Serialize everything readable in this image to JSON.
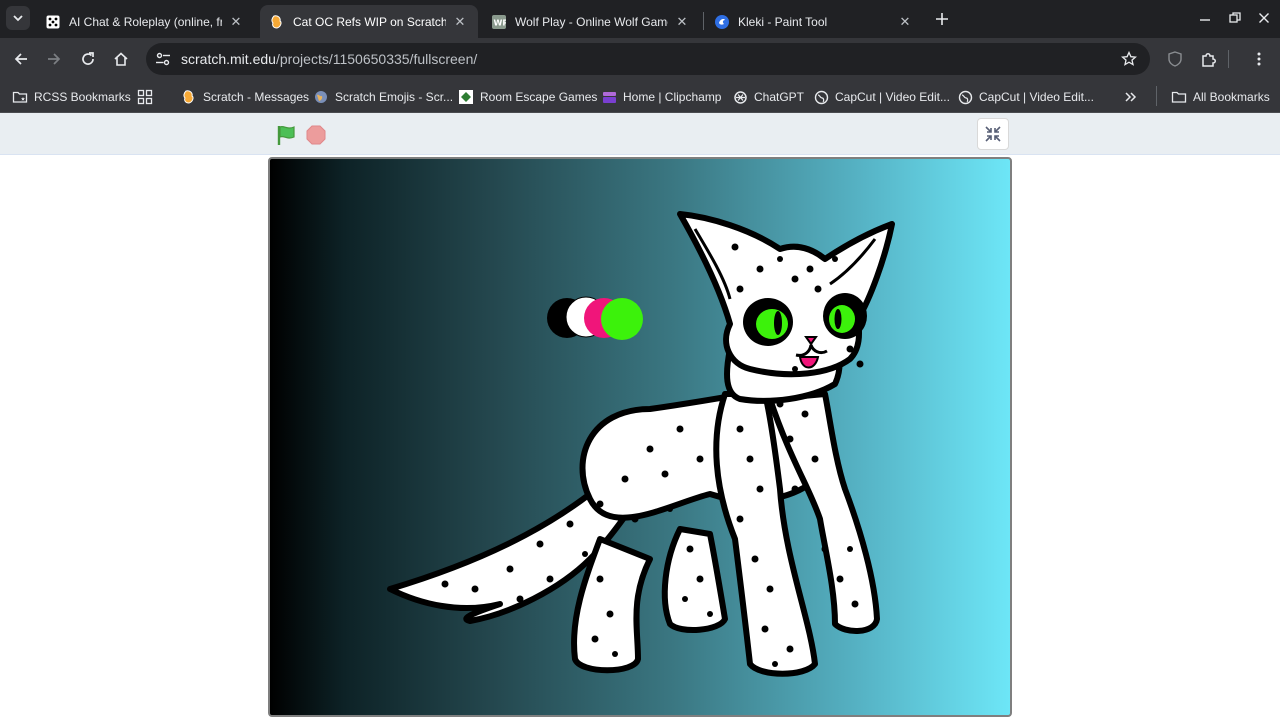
{
  "tabs": [
    {
      "title": "AI Chat & Roleplay (online, free",
      "favicon": "dice-icon",
      "active": false
    },
    {
      "title": "Cat OC Refs WIP on Scratch",
      "favicon": "scratch-icon",
      "active": true
    },
    {
      "title": "Wolf Play - Online Wolf Game!",
      "favicon": "wp-icon",
      "active": false
    },
    {
      "title": "Kleki - Paint Tool",
      "favicon": "kleki-icon",
      "active": false
    }
  ],
  "address_bar": {
    "domain": "scratch.mit.edu",
    "path": "/projects/1150650335/fullscreen/"
  },
  "bookmarks": [
    {
      "label": "RCSS Bookmarks",
      "icon": "folder-star-icon"
    },
    {
      "label": "",
      "icon": "apps-grid-icon"
    },
    {
      "label": "Scratch - Messages",
      "icon": "scratch-icon"
    },
    {
      "label": "Scratch Emojis - Scr...",
      "icon": "globe-icon"
    },
    {
      "label": "Room Escape Games",
      "icon": "room-escape-icon"
    },
    {
      "label": "Home | Clipchamp",
      "icon": "clipchamp-icon"
    },
    {
      "label": "ChatGPT",
      "icon": "chatgpt-icon"
    },
    {
      "label": "CapCut | Video Edit...",
      "icon": "globe-icon"
    },
    {
      "label": "CapCut | Video Edit...",
      "icon": "globe-icon"
    }
  ],
  "all_bookmarks_label": "All Bookmarks",
  "colors": {
    "chrome_dark": "#202124",
    "chrome_toolbar": "#35363a",
    "player_bar": "#e9eef2",
    "flag_green": "#4cbf56",
    "stop_red": "#ec9c9c",
    "cat_eye_green": "#3cf20b",
    "cat_tongue_pink": "#f0157a",
    "palette": [
      "#000000",
      "#ffffff",
      "#f0157a",
      "#3cf20b"
    ]
  }
}
